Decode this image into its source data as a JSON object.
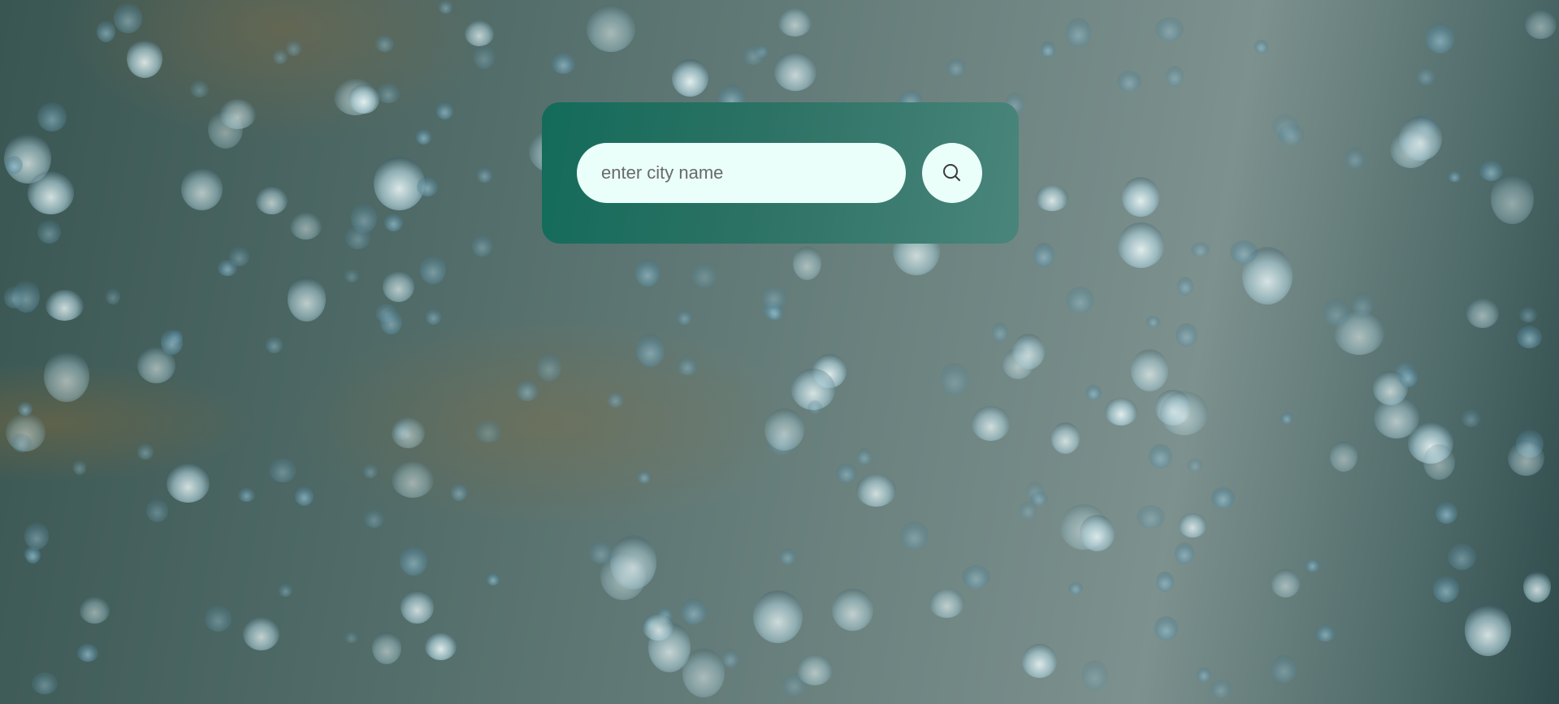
{
  "search": {
    "placeholder": "enter city name",
    "value": "",
    "button_icon": "search-icon"
  },
  "colors": {
    "card_start": "#136b5a",
    "card_end": "#4a857b",
    "input_background": "#eafefa"
  }
}
